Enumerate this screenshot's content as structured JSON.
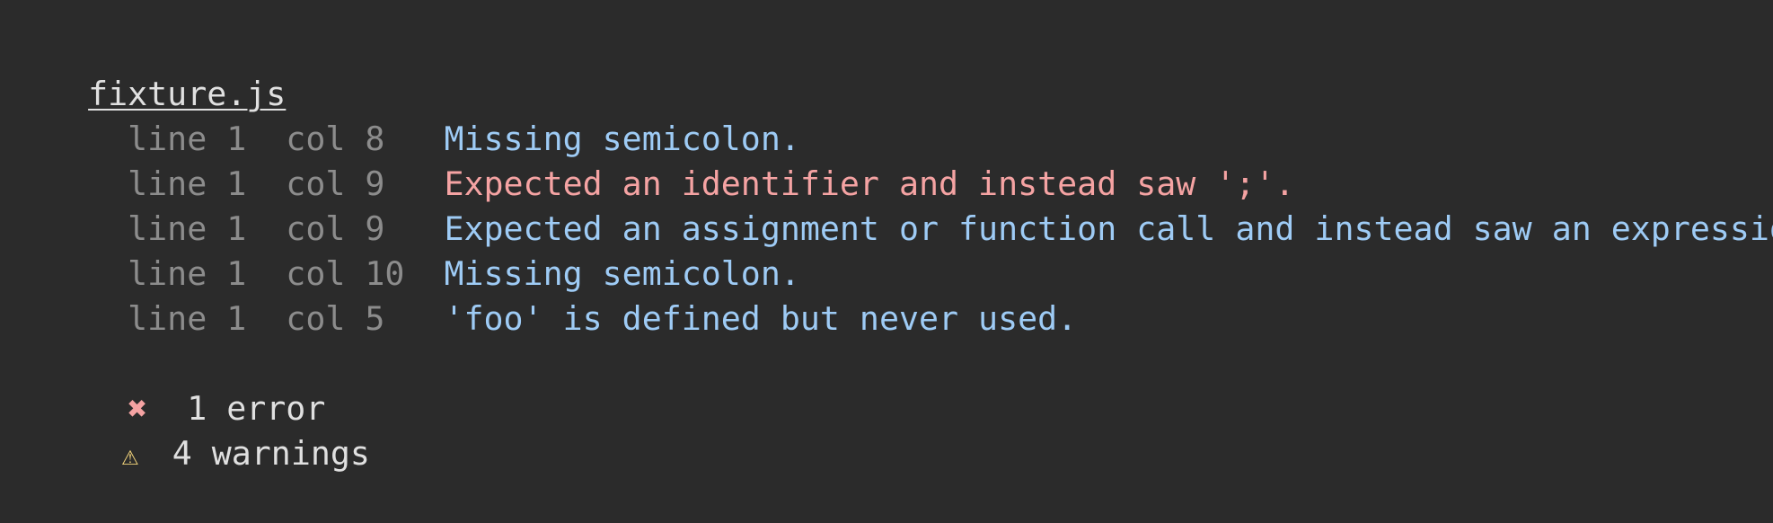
{
  "report": {
    "filename": "fixture.js",
    "messages": [
      {
        "line": "line 1",
        "col": "col 8",
        "severity": "warning",
        "text": "Missing semicolon."
      },
      {
        "line": "line 1",
        "col": "col 9",
        "severity": "error",
        "text": "Expected an identifier and instead saw ';'."
      },
      {
        "line": "line 1",
        "col": "col 9",
        "severity": "warning",
        "text": "Expected an assignment or function call and instead saw an expression."
      },
      {
        "line": "line 1",
        "col": "col 10",
        "severity": "warning",
        "text": "Missing semicolon."
      },
      {
        "line": "line 1",
        "col": "col 5",
        "severity": "warning",
        "text": "'foo' is defined but never used."
      }
    ],
    "summary": {
      "errors": {
        "icon": "✖",
        "icon_name": "error-x-icon",
        "text": "1 error"
      },
      "warnings": {
        "icon": "⚠",
        "icon_name": "warning-triangle-icon",
        "text": "4 warnings"
      }
    }
  },
  "colors": {
    "background": "#2b2b2b",
    "error": "#f5a3a3",
    "warning": "#9ecbf5",
    "location": "#8c8c8c",
    "warning_icon": "#f0d27a"
  }
}
